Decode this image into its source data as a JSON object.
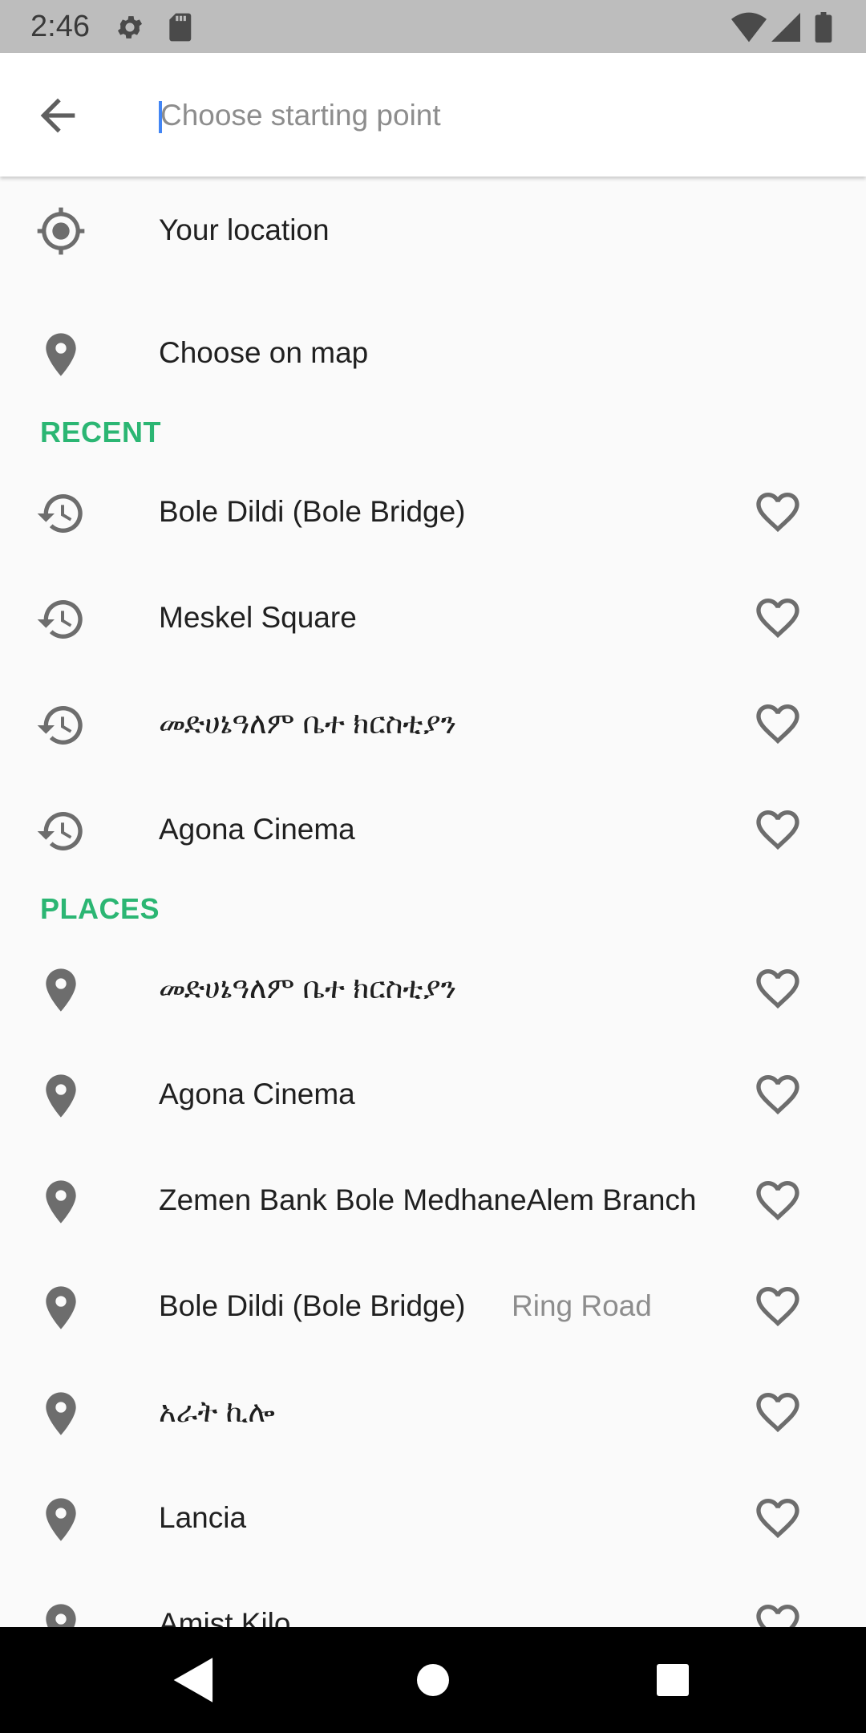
{
  "status_bar": {
    "time": "2:46",
    "icons": [
      "gear-icon",
      "sd-card-icon",
      "wifi-icon",
      "signal-icon",
      "battery-icon"
    ]
  },
  "search": {
    "placeholder": "Choose starting point",
    "value": ""
  },
  "quick_options": [
    {
      "label": "Your location",
      "icon": "my-location-icon"
    },
    {
      "label": "Choose on map",
      "icon": "place-pin-icon"
    }
  ],
  "sections": {
    "recent": {
      "title": "RECENT",
      "items": [
        {
          "label": "Bole Dildi (Bole Bridge)",
          "icon": "history-icon"
        },
        {
          "label": "Meskel Square",
          "icon": "history-icon"
        },
        {
          "label": "መድሀኔዓለም ቤተ ክርስቲያን",
          "icon": "history-icon"
        },
        {
          "label": "Agona Cinema",
          "icon": "history-icon"
        }
      ]
    },
    "places": {
      "title": "PLACES",
      "items": [
        {
          "label": "መድሀኔዓለም ቤተ ክርስቲያን",
          "sublabel": "",
          "icon": "place-pin-icon"
        },
        {
          "label": "Agona Cinema",
          "sublabel": "",
          "icon": "place-pin-icon"
        },
        {
          "label": "Zemen Bank Bole MedhaneAlem Branch",
          "sublabel": "",
          "icon": "place-pin-icon"
        },
        {
          "label": "Bole Dildi (Bole Bridge)",
          "sublabel": "Ring Road",
          "icon": "place-pin-icon"
        },
        {
          "label": "አራት ኪሎ",
          "sublabel": "",
          "icon": "place-pin-icon"
        },
        {
          "label": "Lancia",
          "sublabel": "",
          "icon": "place-pin-icon"
        },
        {
          "label": "Amist Kilo",
          "sublabel": "",
          "icon": "place-pin-icon"
        }
      ]
    }
  },
  "colors": {
    "accent": "#2bb673",
    "icon": "#6d6d6d",
    "caret": "#4285f4"
  }
}
